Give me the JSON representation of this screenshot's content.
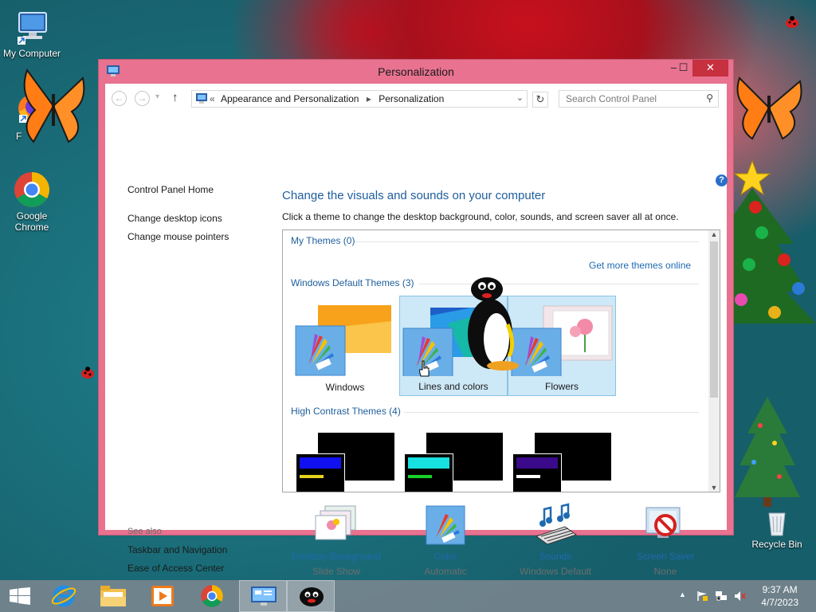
{
  "desktop": {
    "icons": [
      {
        "label": "My Computer"
      },
      {
        "label": "F"
      },
      {
        "label": "Google Chrome"
      },
      {
        "label": "Recycle Bin"
      }
    ]
  },
  "window": {
    "title": "Personalization",
    "buttons": {
      "minimize": "–",
      "maximize": "☐",
      "close": "✕"
    }
  },
  "navbar": {
    "back": "←",
    "forward": "→",
    "up": "↑",
    "chevron": "«",
    "crumb1": "Appearance and Personalization",
    "crumb2": "Personalization",
    "search_placeholder": "Search Control Panel"
  },
  "left_pane": {
    "home": "Control Panel Home",
    "links": [
      "Change desktop icons",
      "Change mouse pointers"
    ],
    "see_also_label": "See also",
    "see_also": [
      "Taskbar and Navigation",
      "Ease of Access Center"
    ]
  },
  "main": {
    "heading": "Change the visuals and sounds on your computer",
    "subheading": "Click a theme to change the desktop background, color, sounds, and screen saver all at once.",
    "help": "?",
    "sections": {
      "my_themes": "My Themes (0)",
      "get_more": "Get more themes online",
      "default_themes": "Windows Default Themes (3)",
      "high_contrast": "High Contrast Themes (4)"
    },
    "default_tiles": [
      {
        "label": "Windows",
        "selected": false
      },
      {
        "label": "Lines and colors",
        "selected": true
      },
      {
        "label": "Flowers",
        "selected": true
      }
    ]
  },
  "bottom": [
    {
      "label": "Desktop Background",
      "sub": "Slide Show"
    },
    {
      "label": "Color",
      "sub": "Automatic"
    },
    {
      "label": "Sounds",
      "sub": "Windows Default"
    },
    {
      "label": "Screen Saver",
      "sub": "None"
    }
  ],
  "taskbar": {
    "time": "9:37 AM",
    "date": "4/7/2023"
  },
  "colors": {
    "window_frame": "#e8728f",
    "close_button": "#c7303f",
    "link": "#1e6ab0",
    "heading": "#1e5e9c",
    "selected_tile": "#cde8f7"
  }
}
